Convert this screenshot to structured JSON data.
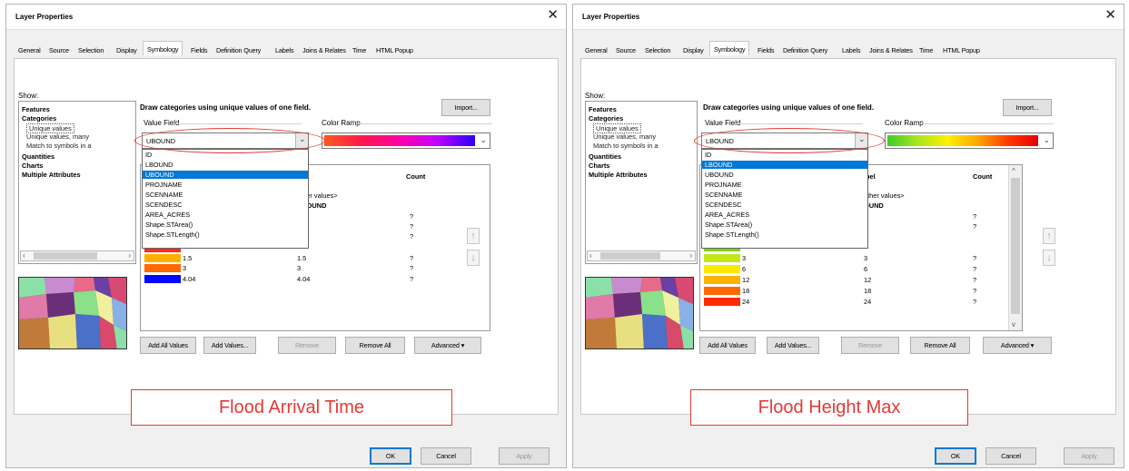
{
  "colors": {
    "highlight": "#0078d7",
    "annotation_red": "#e53935"
  },
  "left_dialog": {
    "title": "Layer Properties",
    "close_glyph": "✕",
    "tabs": [
      "General",
      "Source",
      "Selection",
      "Display",
      "Symbology",
      "Fields",
      "Definition Query",
      "Labels",
      "Joins & Relates",
      "Time",
      "HTML Popup"
    ],
    "active_tab": "Symbology",
    "show_label": "Show:",
    "show_tree": [
      "Features",
      "Categories",
      "Unique values",
      "Unique values, many",
      "Match to symbols in a",
      "Quantities",
      "Charts",
      "Multiple Attributes"
    ],
    "heading": "Draw categories using unique values of one field.",
    "import_label": "Import...",
    "value_field_label": "Value Field",
    "value_field_value": "UBOUND",
    "color_ramp_label": "Color Ramp",
    "ramp_name": "red-to-purple-blue-ramp",
    "field_options": [
      "ID",
      "LBOUND",
      "UBOUND",
      "PROJNAME",
      "SCENNAME",
      "SCENDESC",
      "AREA_ACRES",
      "Shape.STArea()",
      "Shape.STLength()"
    ],
    "highlighted_option": "UBOUND",
    "table_headers": {
      "label": "bel",
      "count": "Count"
    },
    "table_rows": [
      {
        "value": "",
        "label": "other values>",
        "count": ""
      },
      {
        "value": "",
        "label": "UBOUND",
        "count": ""
      },
      {
        "value": "",
        "label": ".5",
        "count": "?"
      },
      {
        "value": "",
        "label": "",
        "count": "?"
      },
      {
        "value": "",
        "label": "",
        "count": "?"
      },
      {
        "value": "1.5",
        "label": "1.5",
        "count": "?"
      },
      {
        "value": "3",
        "label": "3",
        "count": "?"
      },
      {
        "value": "4.04",
        "label": "4.04",
        "count": "?"
      }
    ],
    "buttons": {
      "add_all": "Add All Values",
      "add_values": "Add Values...",
      "remove": "Remove",
      "remove_all": "Remove All",
      "advanced": "Advanced",
      "advanced_caret": "▾"
    },
    "annotation": "Flood Arrival Time",
    "footer": {
      "ok": "OK",
      "cancel": "Cancel",
      "apply": "Apply"
    }
  },
  "right_dialog": {
    "title": "Layer Properties",
    "close_glyph": "✕",
    "tabs": [
      "General",
      "Source",
      "Selection",
      "Display",
      "Symbology",
      "Fields",
      "Definition Query",
      "Labels",
      "Joins & Relates",
      "Time",
      "HTML Popup"
    ],
    "active_tab": "Symbology",
    "show_label": "Show:",
    "show_tree": [
      "Features",
      "Categories",
      "Unique values",
      "Unique values, many",
      "Match to symbols in a",
      "Quantities",
      "Charts",
      "Multiple Attributes"
    ],
    "heading": "Draw categories using unique values of one field.",
    "import_label": "Import...",
    "value_field_label": "Value Field",
    "value_field_value": "LBOUND",
    "color_ramp_label": "Color Ramp",
    "ramp_name": "green-to-red-ramp",
    "field_options": [
      "ID",
      "LBOUND",
      "UBOUND",
      "PROJNAME",
      "SCENNAME",
      "SCENDESC",
      "AREA_ACRES",
      "Shape.STArea()",
      "Shape.STLength()"
    ],
    "highlighted_option": "LBOUND",
    "table_headers": {
      "label": "bel",
      "count": "Count"
    },
    "table_rows": [
      {
        "value": "",
        "label": "other values>",
        "count": ""
      },
      {
        "value": "",
        "label": "OUND",
        "count": ""
      },
      {
        "value": "",
        "label": "",
        "count": "?"
      },
      {
        "value": "",
        "label": "",
        "count": "?"
      },
      {
        "value": "3",
        "label": "3",
        "count": "?"
      },
      {
        "value": "6",
        "label": "6",
        "count": "?"
      },
      {
        "value": "12",
        "label": "12",
        "count": "?"
      },
      {
        "value": "18",
        "label": "18",
        "count": "?"
      },
      {
        "value": "24",
        "label": "24",
        "count": "?"
      }
    ],
    "buttons": {
      "add_all": "Add All Values",
      "add_values": "Add Values...",
      "remove": "Remove",
      "remove_all": "Remove All",
      "advanced": "Advanced",
      "advanced_caret": "▾"
    },
    "annotation": "Flood Height Max",
    "footer": {
      "ok": "OK",
      "cancel": "Cancel",
      "apply": "Apply"
    }
  }
}
